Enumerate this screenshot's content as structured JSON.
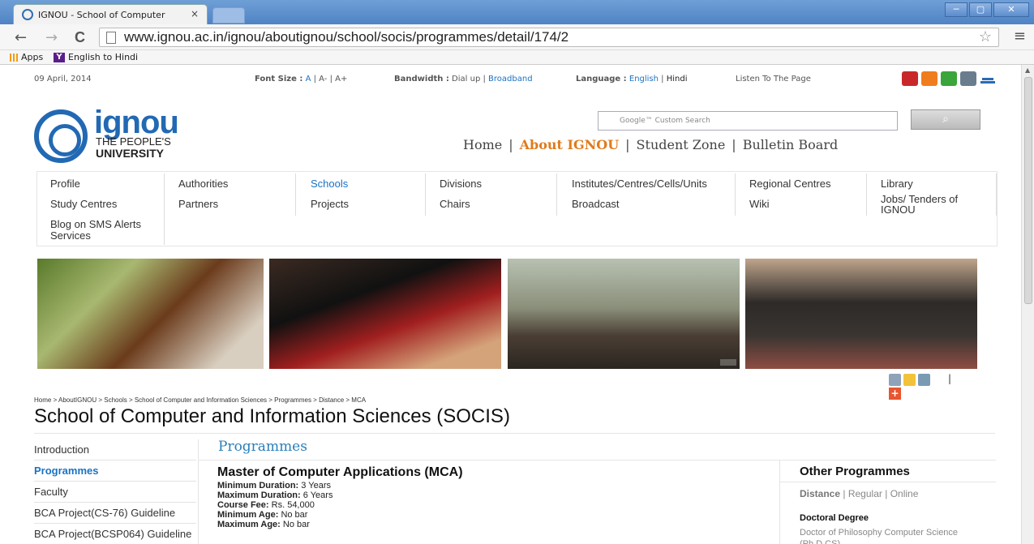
{
  "browser": {
    "tab_title": "IGNOU - School of Computer",
    "tab_close": "×",
    "url": "www.ignou.ac.in/ignou/aboutignou/school/socis/programmes/detail/174/2",
    "back": "←",
    "forward": "→",
    "reload": "C",
    "star": "☆",
    "menu": "≡",
    "window_buttons": {
      "minimize": "─",
      "maximize": "▢",
      "close": "✕"
    },
    "bookmarks": [
      {
        "label": "Apps",
        "icon": "apps-grid-icon"
      },
      {
        "label": "English to Hindi",
        "icon": "yahoo-y-icon",
        "icon_glyph": "Y"
      }
    ]
  },
  "topbar": {
    "date": "09 April, 2014",
    "font_size_label": "Font Size :",
    "font_sizes": [
      "A",
      "A-",
      "A+"
    ],
    "bandwidth_label": "Bandwidth :",
    "dialup": "Dial up",
    "broadband": "Broadband",
    "language_label": "Language :",
    "english": "English",
    "hindi": "Hindi",
    "listen": "Listen To The Page",
    "icons": [
      "youtube-icon",
      "rss-icon",
      "chat-icon",
      "book-icon",
      "sitemap-icon"
    ]
  },
  "logo": {
    "name": "ignou",
    "line1": "THE PEOPLE'S",
    "line2": "UNIVERSITY"
  },
  "search": {
    "placeholder": "Google™ Custom Search",
    "button_icon": "search-icon",
    "button_glyph": "⌕"
  },
  "main_nav": {
    "items": [
      "Home",
      "About IGNOU",
      "Student Zone",
      "Bulletin Board"
    ],
    "active": "About IGNOU"
  },
  "sub_nav": {
    "row1": [
      "Profile",
      "Authorities",
      "Schools",
      "Divisions",
      "Institutes/Centres/Cells/Units",
      "Regional Centres",
      "Library"
    ],
    "row2": [
      "Study Centres",
      "Partners",
      "Projects",
      "Chairs",
      "Broadcast",
      "Wiki",
      "Jobs/ Tenders of",
      "IGNOU"
    ],
    "row3": [
      "Blog on SMS Alerts",
      "Services"
    ],
    "current": "Schools"
  },
  "share": {
    "icons": [
      "email-icon",
      "favorite-star-icon",
      "print-icon",
      "add-plus-icon"
    ],
    "separator": "|",
    "plus": "+"
  },
  "breadcrumb": "Home > AboutIGNOU > Schools > School of Computer and Information Sciences > Programmes > Distance > MCA",
  "page_title": "School of Computer and Information Sciences (SOCIS)",
  "left_nav": [
    "Introduction",
    "Programmes",
    "Faculty",
    "BCA Project(CS-76) Guideline",
    "BCA Project(BCSP064) Guideline"
  ],
  "left_nav_active": "Programmes",
  "programme": {
    "section_heading": "Programmes",
    "title": "Master of Computer Applications (MCA)",
    "details": [
      {
        "label": "Minimum Duration:",
        "value": "3 Years"
      },
      {
        "label": "Maximum Duration:",
        "value": "6 Years"
      },
      {
        "label": "Course Fee:",
        "value": "Rs. 54,000"
      },
      {
        "label": "Minimum Age:",
        "value": "No bar"
      },
      {
        "label": "Maximum Age:",
        "value": "No bar"
      }
    ]
  },
  "other_programmes": {
    "heading": "Other Programmes",
    "links": [
      "Distance",
      "Regular",
      "Online"
    ],
    "separator": "|",
    "doctoral_heading": "Doctoral Degree",
    "doctoral_link": "Doctor of Philosophy Computer Science (Ph.D.CS)"
  },
  "colors": {
    "accent_blue": "#1a72c4",
    "active_orange": "#e07b1b",
    "logo_blue": "#2269b3",
    "heading_blue": "#2a7fb8"
  }
}
